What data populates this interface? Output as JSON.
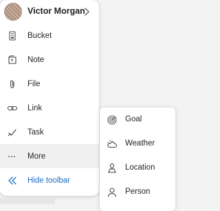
{
  "profile": {
    "name": "Victor Morgan",
    "avatar_icon": "user-photo-avatar",
    "chevron_icon": "chevron-right-icon"
  },
  "menu": {
    "items": [
      {
        "label": "Bucket",
        "icon": "bucket-icon"
      },
      {
        "label": "Note",
        "icon": "note-icon"
      },
      {
        "label": "File",
        "icon": "paperclip-icon"
      },
      {
        "label": "Link",
        "icon": "link-icon"
      },
      {
        "label": "Task",
        "icon": "checkmark-icon"
      },
      {
        "label": "More",
        "icon": "ellipsis-icon",
        "highlighted": true
      },
      {
        "label": "Hide toolbar",
        "icon": "double-chevron-left-icon",
        "accent": true
      }
    ]
  },
  "submenu": {
    "items": [
      {
        "label": "Goal",
        "icon": "target-icon"
      },
      {
        "label": "Weather",
        "icon": "weather-icon"
      },
      {
        "label": "Location",
        "icon": "location-icon"
      },
      {
        "label": "Person",
        "icon": "person-icon"
      }
    ]
  },
  "colors": {
    "accent": "#1d6fc8",
    "text": "#242424",
    "highlight_bg": "#f0f0f0",
    "background": "#f3f3f3"
  }
}
